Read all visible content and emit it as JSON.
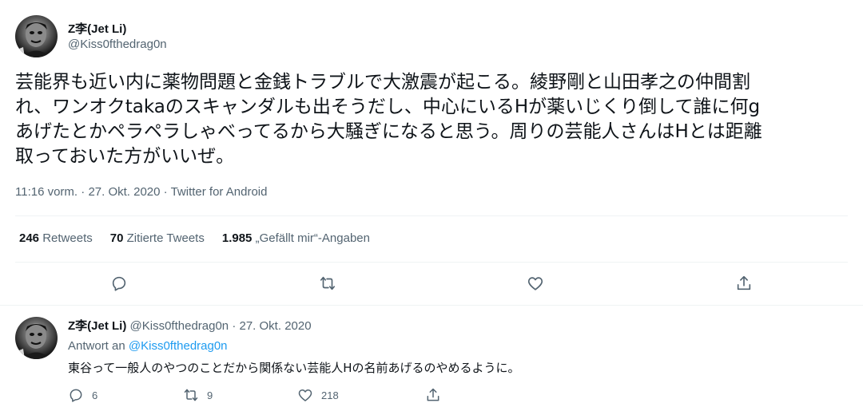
{
  "tweet": {
    "display_name": "Z李(Jet Li)",
    "handle": "@Kiss0fthedrag0n",
    "text": "芸能界も近い内に薬物問題と金銭トラブルで大激震が起こる。綾野剛と山田孝之の仲間割\nれ、ワンオクtakaのスキャンダルも出そうだし、中心にいるHが薬いじくり倒して誰に何g\nあげたとかペラペラしゃべってるから大騒ぎになると思う。周りの芸能人さんはHとは距離\n取っておいた方がいいぜ。",
    "time": "11:16 vorm.",
    "date": "27. Okt. 2020",
    "source": "Twitter for Android",
    "dot": "·",
    "stats": {
      "retweets_count": "246",
      "retweets_label": "Retweets",
      "quotes_count": "70",
      "quotes_label": "Zitierte Tweets",
      "likes_count": "1.985",
      "likes_label": "„Gefällt mir“-Angaben"
    },
    "actions": [
      "reply-icon",
      "retweet-icon",
      "like-icon",
      "share-icon"
    ]
  },
  "reply": {
    "display_name": "Z李(Jet Li)",
    "handle": "@Kiss0fthedrag0n",
    "dot": "·",
    "date": "27. Okt. 2020",
    "reply_to_label": "Antwort an",
    "reply_to_handle": "@Kiss0fthedrag0n",
    "text": "東谷って一般人のやつのことだから関係ない芸能人Hの名前あげるのやめるように。",
    "reply_count": "6",
    "retweet_count": "9",
    "like_count": "218"
  },
  "colors": {
    "text": "#0f1419",
    "secondary": "#536471",
    "link": "#1d9bf0",
    "divider": "#eff3f4"
  }
}
